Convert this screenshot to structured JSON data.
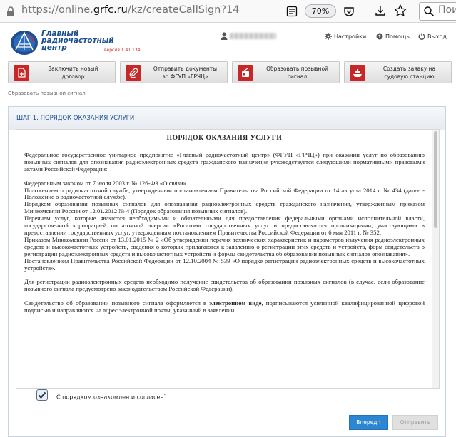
{
  "browser": {
    "url_prefix": "https://online.",
    "url_domain": "grfc.ru",
    "url_path": "/kz/createCallSign?14",
    "zoom": "70%",
    "search_placeholder": "Поиск"
  },
  "header": {
    "logo_line1": "Главный",
    "logo_line2": "радиочастотный",
    "logo_line3": "центр",
    "version": "версия 1.41.134",
    "settings_label": "Настройки",
    "help_label": "Помощь",
    "logout_label": "Выход"
  },
  "actions": [
    {
      "line1": "Заключить новый",
      "line2": "договор",
      "icon": "new-document-icon"
    },
    {
      "line1": "Отправить документы",
      "line2": "во ФГУП «ГРЧЦ»",
      "icon": "paperclip-icon"
    },
    {
      "line1": "Образовать позывной",
      "line2": "сигнал",
      "icon": "radio-icon"
    },
    {
      "line1": "Создать заявку на",
      "line2": "судовую станцию",
      "icon": "ship-icon"
    }
  ],
  "breadcrumb": "Образовать позывной сигнал",
  "step": {
    "title": "ШАГ 1. ПОРЯДОК ОКАЗАНИЯ УСЛУГИ",
    "doc_title": "ПОРЯДОК ОКАЗАНИЯ УСЛУГИ",
    "intro": "Федеральное государственное унитарное предприятие «Главный радиочастотный центр» (ФГУП «ГРЧЦ») при оказании услуг по образованию позывных сигналов для опознавания радиоэлектронных средств гражданского назначения руководствуется следующими нормативными правовыми актами Российской Федерации:",
    "acts": [
      "Федеральным законом от 7 июля 2003 г. № 126-ФЗ «О связи».",
      "Положением о радиочастотной службе, утвержденным постановлением Правительства Российской Федерации от 14 августа 2014 г. № 434 (далее - Положение о радиочастотной службе).",
      "Порядком образования позывных сигналов для опознавания радиоэлектронных средств гражданского назначения, утвержденным приказом Минкомсвязи России от 12.01.2012 № 4 (Порядок образования позывных сигналов).",
      "Перечнем услуг, которые являются необходимыми и обязательными для предоставления федеральными органами исполнительной власти, государственной корпорацией по атомной энергии «Росатом» государственных услуг и предоставляются организациями, участвующими в предоставлении государственных услуг, утвержденным постановлением Правительства Российской Федерации от 6 мая 2011 г. № 352.",
      "Приказом Минкомсвязи России от 13.01.2015 № 2 «Об утверждении перечня технических характеристик и параметров излучения радиоэлектронных средств и высокочастотных устройств, сведения о которых прилагаются к заявлению о регистрации этих средств и устройств, форм свидетельств о регистрации радиоэлектронных средств и высокочастотных устройств и формы свидетельства об образовании позывных сигналов опознавания».",
      "Постановлением Правительства Российской Федерации от 12.10.2004 № 539 «О порядке регистрации радиоэлектронных средств и высокочастотных устройств»."
    ],
    "para2": "Для регистрации радиоэлектронных средств необходимо получение свидетельства об образовании позывных сигналов (в случае, если образование позывного сигнала предусмотрено законодательством Российской Федерации).",
    "para3_a": "Свидетельство об образовании позывного сигнала оформляется в ",
    "para3_bold": "электронном виде",
    "para3_b": ", подписываются усиленной квалифицированной цифровой подписью и направляются на адрес электронной почты, указанный в заявлении.",
    "agree_label": "С порядком ознакомлен и согласен",
    "agree_mark": "*",
    "agree_checked": true
  },
  "buttons": {
    "next_label": "Вперед ›",
    "send_label": "Отправить"
  },
  "colors": {
    "brand_blue": "#1d4f91",
    "accent_red": "#c62828",
    "primary_button": "#2c86d1"
  }
}
